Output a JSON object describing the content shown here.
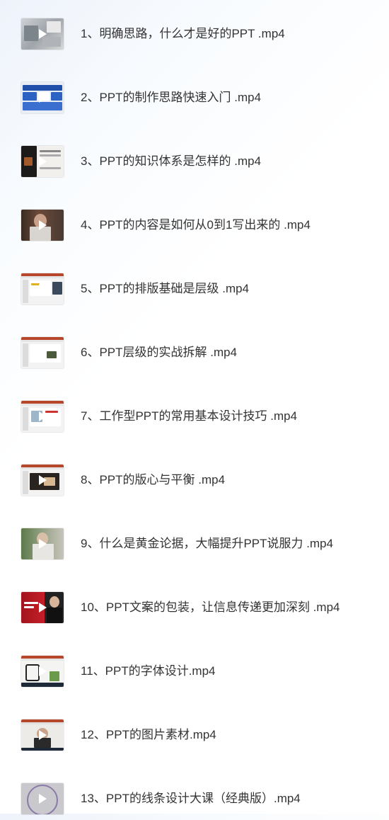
{
  "videos": [
    {
      "title": "1、明确思路，什么才是好的PPT .mp4",
      "thumbnail": "meeting-photo",
      "icon": "play-icon"
    },
    {
      "title": "2、PPT的制作思路快速入门 .mp4",
      "thumbnail": "blue-slides",
      "icon": "play-icon"
    },
    {
      "title": "3、PPT的知识体系是怎样的 .mp4",
      "thumbnail": "dark-collage",
      "icon": "play-icon"
    },
    {
      "title": "4、PPT的内容是如何从0到1写出来的 .mp4",
      "thumbnail": "woman-speaking",
      "icon": "play-icon"
    },
    {
      "title": "5、PPT的排版基础是层级 .mp4",
      "thumbnail": "powerpoint-window",
      "icon": "play-icon"
    },
    {
      "title": "6、PPT层级的实战拆解 .mp4",
      "thumbnail": "powerpoint-window",
      "icon": "play-icon"
    },
    {
      "title": "7、工作型PPT的常用基本设计技巧 .mp4",
      "thumbnail": "powerpoint-window",
      "icon": "play-icon"
    },
    {
      "title": "8、PPT的版心与平衡 .mp4",
      "thumbnail": "powerpoint-window",
      "icon": "play-icon"
    },
    {
      "title": "9、什么是黄金论据，大幅提升PPT说服力  .mp4",
      "thumbnail": "man-photo",
      "icon": "play-icon"
    },
    {
      "title": "10、PPT文案的包装，让信息传递更加深刻 .mp4",
      "thumbnail": "red-slide",
      "icon": "play-icon"
    },
    {
      "title": "11、PPT的字体设计.mp4",
      "thumbnail": "calligraphy",
      "icon": "play-icon"
    },
    {
      "title": "12、PPT的图片素材.mp4",
      "thumbnail": "portrait-slide",
      "icon": "play-icon"
    },
    {
      "title": "13、PPT的线条设计大课（经典版）.mp4",
      "thumbnail": "gray-circle",
      "icon": "play-icon"
    }
  ],
  "colors": {
    "title_text": "#333333",
    "powerpoint_red": "#b7472a",
    "play_icon": "#ffffff"
  }
}
